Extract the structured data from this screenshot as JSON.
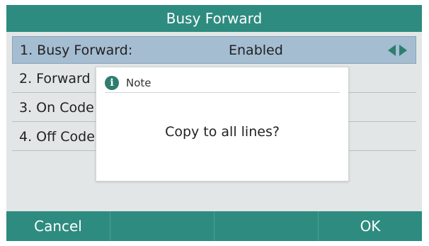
{
  "title": "Busy Forward",
  "rows": [
    {
      "label": "1. Busy Forward:",
      "value": "Enabled"
    },
    {
      "label": "2. Forward"
    },
    {
      "label": "3. On Code"
    },
    {
      "label": "4. Off Code"
    }
  ],
  "dialog": {
    "title": "Note",
    "message": "Copy to all lines?",
    "icon": "info-icon"
  },
  "softkeys": [
    "Cancel",
    "",
    "",
    "OK"
  ],
  "colors": {
    "accent": "#2e8b7f",
    "selected_row": "#a4bdd1",
    "background": "#e2e6e6"
  }
}
